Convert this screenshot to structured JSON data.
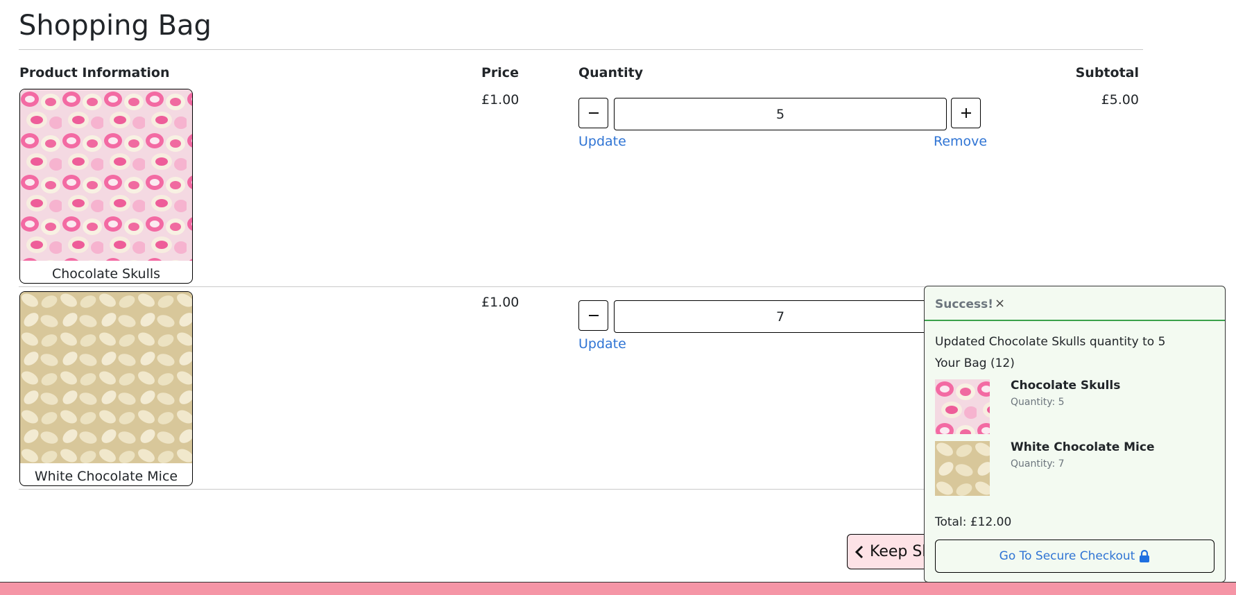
{
  "page": {
    "title": "Shopping Bag"
  },
  "table": {
    "headers": {
      "product": "Product Information",
      "price": "Price",
      "quantity": "Quantity",
      "subtotal": "Subtotal"
    }
  },
  "items": [
    {
      "name": "Chocolate Skulls",
      "price": "£1.00",
      "quantity": "5",
      "subtotal": "£5.00",
      "image_icon": "pink-white-skull-sweets-photo"
    },
    {
      "name": "White Chocolate Mice",
      "price": "£1.00",
      "quantity": "7",
      "image_icon": "white-chocolate-mice-photo"
    }
  ],
  "actions": {
    "decrement_icon": "minus-icon",
    "increment_icon": "plus-icon",
    "update_label": "Update",
    "remove_label": "Remove",
    "keep_shopping_label": "Keep Sh"
  },
  "toast": {
    "title": "Success!",
    "close_label": "×",
    "message": "Updated Chocolate Skulls quantity to 5",
    "bag_label": "Your Bag (12)",
    "items": [
      {
        "name": "Chocolate Skulls",
        "quantity_label": "Quantity: 5"
      },
      {
        "name": "White Chocolate Mice",
        "quantity_label": "Quantity: 7"
      }
    ],
    "total_label": "Total: £12.00",
    "checkout_label": "Go To Secure Checkout",
    "checkout_icon": "lock-icon"
  },
  "colors": {
    "link": "#2f74d4",
    "toast_bg": "#f3faf1",
    "toast_accent": "#3aa14a",
    "footer": "#f595a6",
    "keep_shopping_bg": "#fde2e6"
  }
}
